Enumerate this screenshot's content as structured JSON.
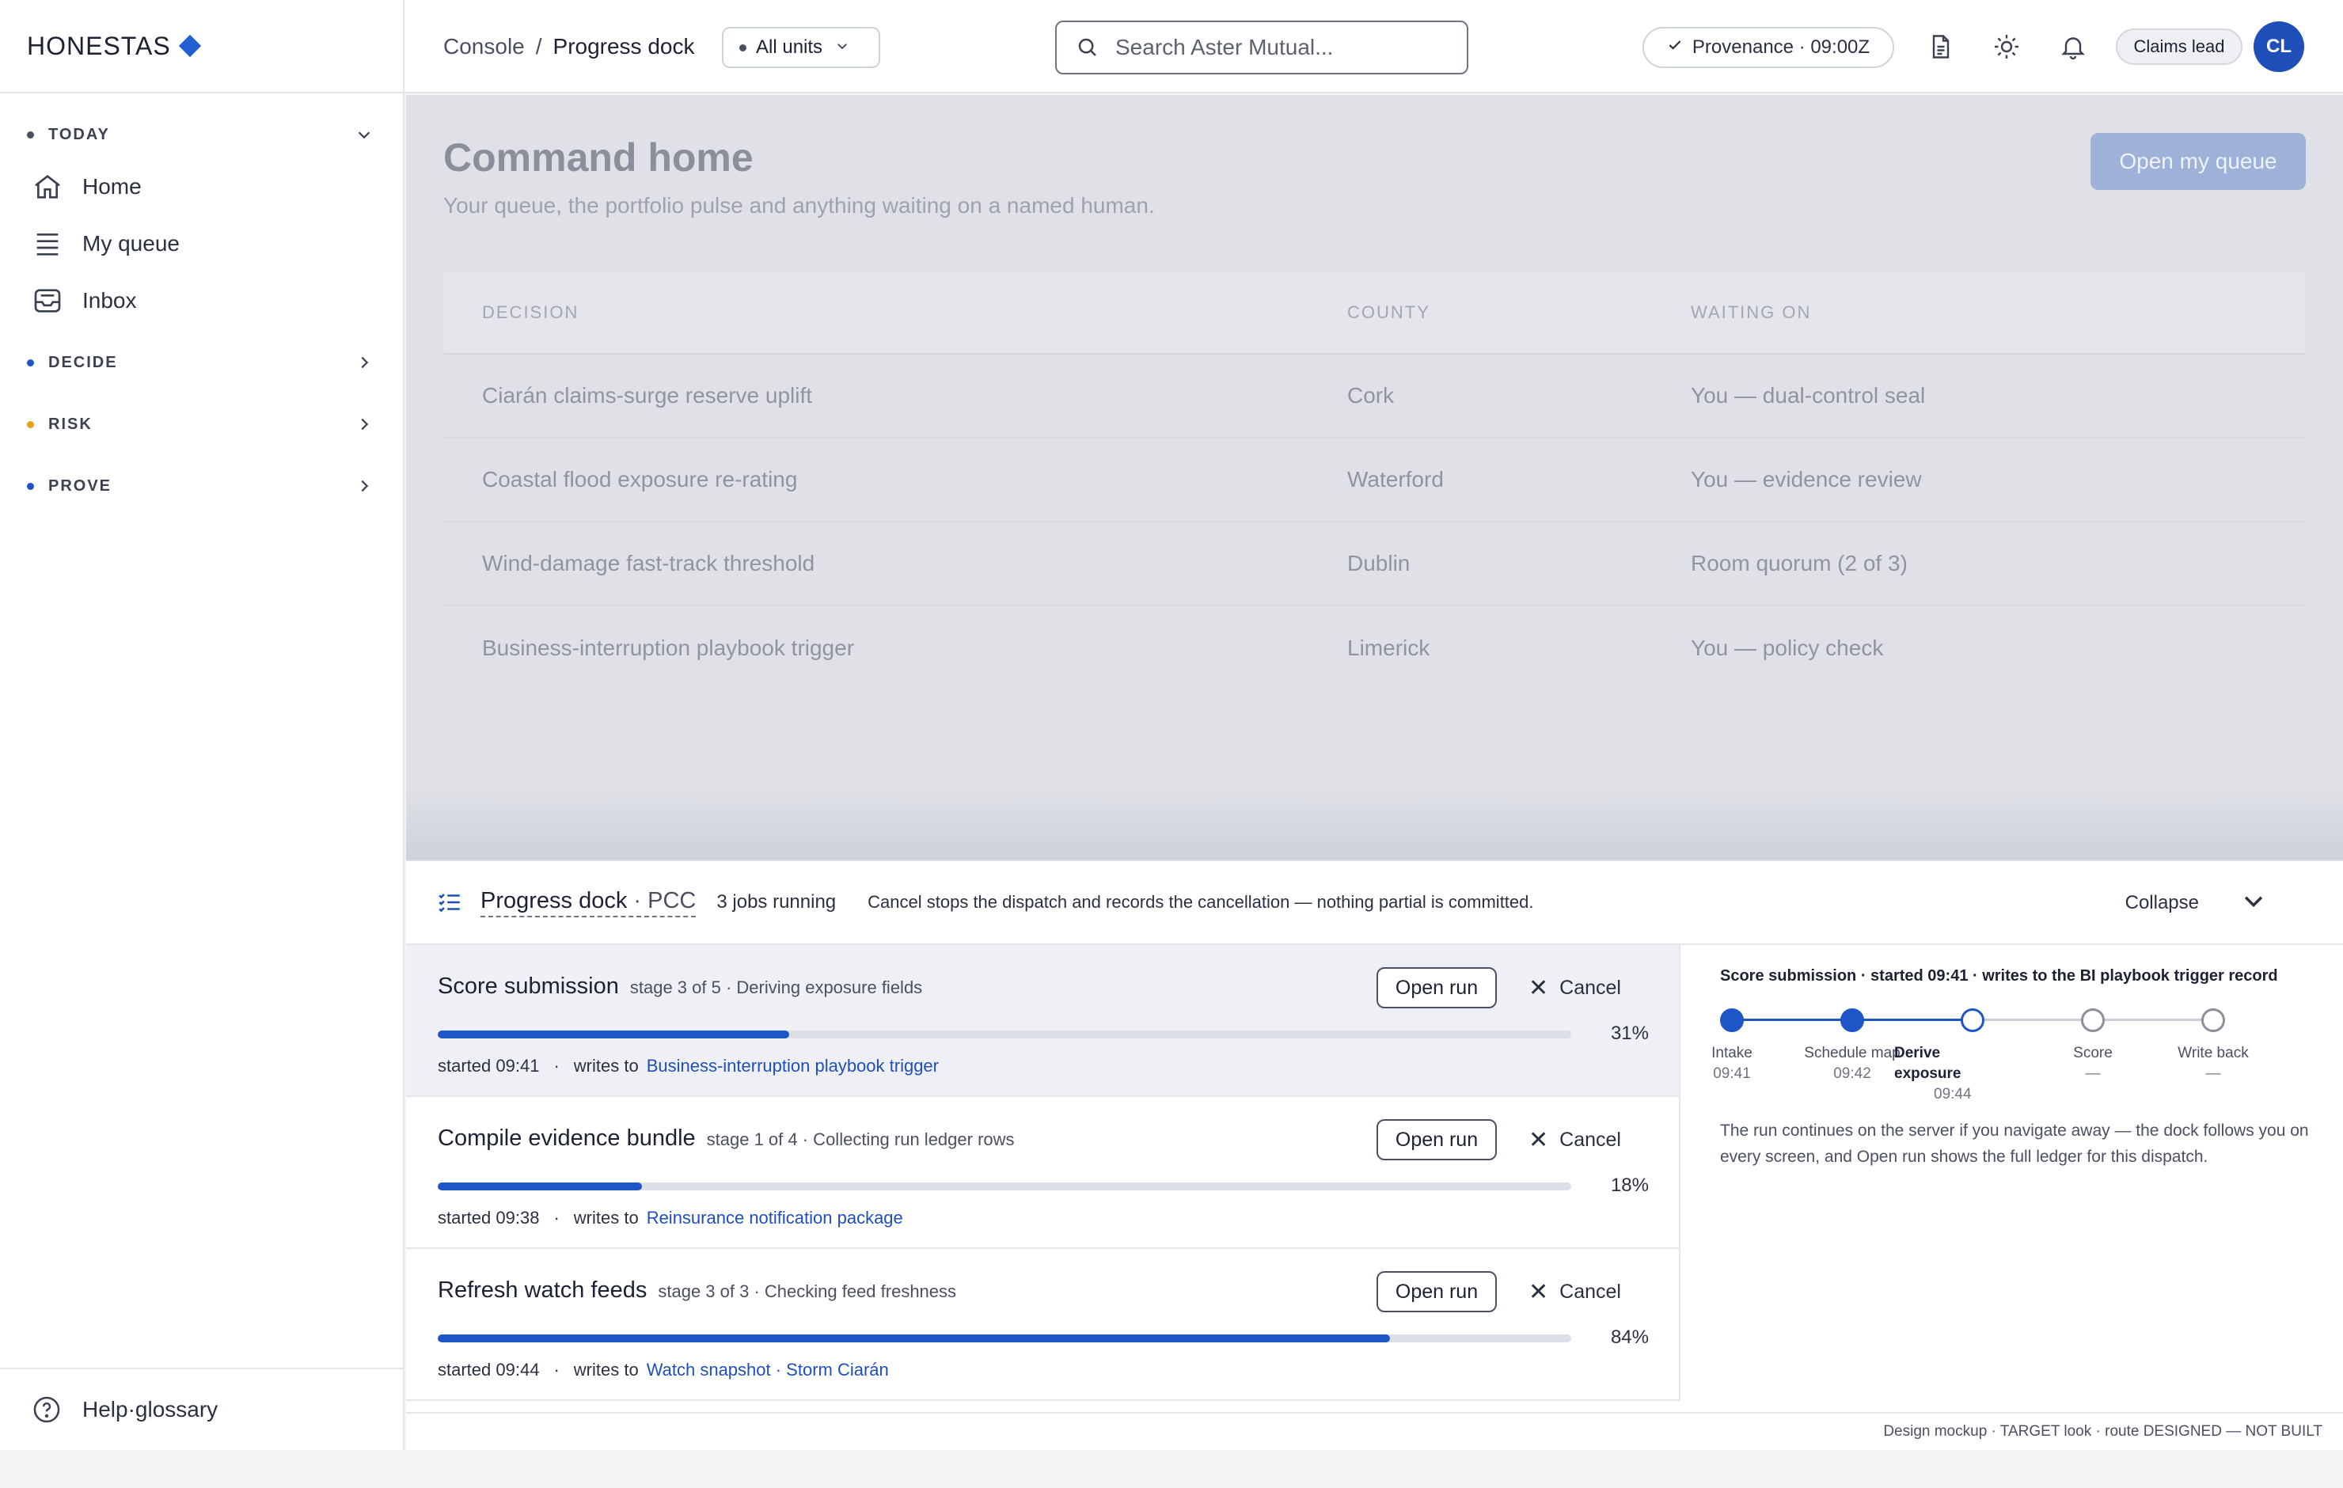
{
  "brand": {
    "name": "HONESTAS",
    "accent": "#1f5fd1"
  },
  "sidebar": {
    "sections": [
      {
        "label": "TODAY",
        "dot_color": "#4b5060",
        "expanded": true,
        "items": [
          {
            "label": "Home",
            "icon": "home-icon"
          },
          {
            "label": "My queue",
            "icon": "list-icon"
          },
          {
            "label": "Inbox",
            "icon": "inbox-icon"
          }
        ]
      },
      {
        "label": "DECIDE",
        "dot_color": "#1f56c7",
        "expanded": false
      },
      {
        "label": "RISK",
        "dot_color": "#e6a21a",
        "expanded": false
      },
      {
        "label": "PROVE",
        "dot_color": "#1f56c7",
        "expanded": false
      }
    ],
    "footer": {
      "label": "Help·glossary",
      "icon": "help-icon"
    }
  },
  "header": {
    "breadcrumb": {
      "root": "Console",
      "sep": "/",
      "current": "Progress dock"
    },
    "unit_select": "All units",
    "search_placeholder": "Search Aster Mutual...",
    "provenance": "Provenance · 09:00Z",
    "role": "Claims lead",
    "avatar": "CL"
  },
  "main": {
    "title": "Command home",
    "subtitle": "Your queue, the portfolio pulse and anything waiting on a named human.",
    "queue_button": "Open my queue",
    "table": {
      "headers": [
        "DECISION",
        "COUNTY",
        "WAITING ON"
      ],
      "rows": [
        [
          "Ciarán claims-surge reserve uplift",
          "Cork",
          "You — dual-control seal"
        ],
        [
          "Coastal flood exposure re-rating",
          "Waterford",
          "You — evidence review"
        ],
        [
          "Wind-damage fast-track threshold",
          "Dublin",
          "Room quorum (2 of 3)"
        ],
        [
          "Business-interruption playbook trigger",
          "Limerick",
          "You — policy check"
        ]
      ]
    }
  },
  "dock": {
    "title": "Progress dock",
    "title_sub": "· PCC",
    "jobs_running": "3 jobs running",
    "note": "Cancel stops the dispatch and records the cancellation — nothing partial is committed.",
    "collapse_label": "Collapse",
    "open_label": "Open run",
    "cancel_label": "Cancel",
    "writes_to_label": "writes to",
    "jobs": [
      {
        "title": "Score submission",
        "stage": "stage 3 of 5 · Deriving exposure fields",
        "progress": 31,
        "pct": "31%",
        "started": "started 09:41",
        "target": "Business-interruption playbook trigger"
      },
      {
        "title": "Compile evidence bundle",
        "stage": "stage 1 of 4 · Collecting run ledger rows",
        "progress": 18,
        "pct": "18%",
        "started": "started 09:38",
        "target": "Reinsurance notification package"
      },
      {
        "title": "Refresh watch feeds",
        "stage": "stage 3 of 3 · Checking feed freshness",
        "progress": 84,
        "pct": "84%",
        "started": "started 09:44",
        "target": "Watch snapshot · Storm Ciarán"
      }
    ],
    "detail": {
      "heading": "Score submission · started 09:41 · writes to the BI playbook trigger record",
      "steps": [
        {
          "label": "Intake",
          "time": "09:41",
          "state": "done"
        },
        {
          "label": "Schedule map",
          "time": "09:42",
          "state": "done"
        },
        {
          "label": "Derive exposure",
          "time": "09:44",
          "state": "current"
        },
        {
          "label": "Score",
          "time": "—",
          "state": "pending"
        },
        {
          "label": "Write back",
          "time": "—",
          "state": "pending"
        }
      ],
      "body": "The run continues on the server if you navigate away — the dock follows you on every screen, and Open run shows the full ledger for this dispatch."
    },
    "footer": "Design mockup · TARGET look · route DESIGNED — NOT BUILT"
  }
}
